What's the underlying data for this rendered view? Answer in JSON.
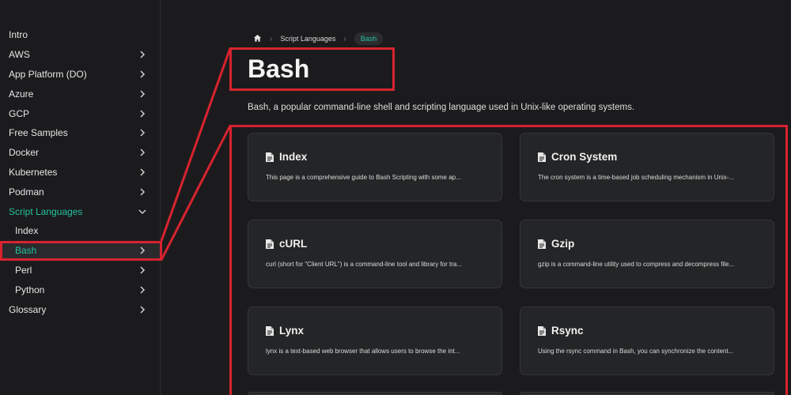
{
  "sidebar": {
    "items": [
      {
        "label": "Intro",
        "chevron": "none"
      },
      {
        "label": "AWS",
        "chevron": "right"
      },
      {
        "label": "App Platform (DO)",
        "chevron": "right"
      },
      {
        "label": "Azure",
        "chevron": "right"
      },
      {
        "label": "GCP",
        "chevron": "right"
      },
      {
        "label": "Free Samples",
        "chevron": "right"
      },
      {
        "label": "Docker",
        "chevron": "right"
      },
      {
        "label": "Kubernetes",
        "chevron": "right"
      },
      {
        "label": "Podman",
        "chevron": "right"
      },
      {
        "label": "Script Languages",
        "chevron": "down"
      },
      {
        "label": "Index",
        "chevron": "none"
      },
      {
        "label": "Bash",
        "chevron": "right"
      },
      {
        "label": "Perl",
        "chevron": "right"
      },
      {
        "label": "Python",
        "chevron": "right"
      },
      {
        "label": "Glossary",
        "chevron": "right"
      }
    ]
  },
  "breadcrumb": {
    "home_icon": "home-icon",
    "items": [
      "Script Languages",
      "Bash"
    ]
  },
  "page": {
    "title": "Bash",
    "description": "Bash, a popular command-line shell and scripting language used in Unix-like operating systems."
  },
  "cards": [
    {
      "title": "Index",
      "description": "This page is a comprehensive guide to Bash Scripting with some ap..."
    },
    {
      "title": "Cron System",
      "description": "The cron system is a time-based job scheduling mechanism in Unix-..."
    },
    {
      "title": "cURL",
      "description": "curl (short for \"Client URL\") is a command-line tool and library for tra..."
    },
    {
      "title": "Gzip",
      "description": "gzip is a command-line utility used to compress and decompress file..."
    },
    {
      "title": "Lynx",
      "description": "lynx is a text-based web browser that allows users to browse the int..."
    },
    {
      "title": "Rsync",
      "description": "Using the rsync command in Bash, you can synchronize the content..."
    }
  ],
  "colors": {
    "accent": "#25c2a0",
    "highlight": "#d7232f",
    "background": "#1b1b1d"
  }
}
